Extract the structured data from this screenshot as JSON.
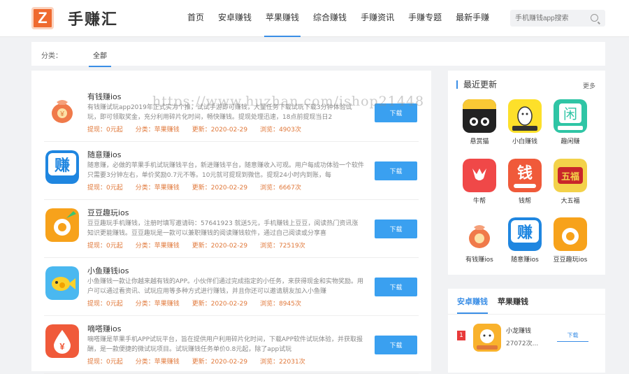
{
  "header": {
    "logo_letter": "Z",
    "logo_text": "手赚汇",
    "nav": [
      "首页",
      "安卓赚钱",
      "苹果赚钱",
      "综合赚钱",
      "手赚资讯",
      "手赚专题",
      "最新手赚"
    ],
    "active_nav": "苹果赚钱",
    "search_placeholder": "手机赚钱app搜索"
  },
  "filter": {
    "label": "分类：",
    "selected": "全部"
  },
  "apps": [
    {
      "name": "有钱赚ios",
      "desc": "有钱赚试玩app2019年正式实力个推，试试手游即可赚钱，大量任务下载试玩下载3分钟体验试玩，即可领取奖金，充分利用碎片化时间，畅快赚钱。提现处理迅速，18点前提现当日2",
      "withdraw": "提现：0元起",
      "category": "分类：苹果赚钱",
      "updated": "更新：2020-02-29",
      "views": "浏览：4903次",
      "button": "下载"
    },
    {
      "name": "随意赚ios",
      "desc": "随意赚，必做的苹果手机试玩赚钱平台，新进赚钱平台，随意赚收入可观。用户每成功体验一个软件只需要3分钟左右，单价奖励0.7元不等。10元就可提现到微信。提现24小时内到账，每",
      "withdraw": "提现：0元起",
      "category": "分类：苹果赚钱",
      "updated": "更新：2020-02-29",
      "views": "浏览：6667次",
      "button": "下载"
    },
    {
      "name": "豆豆趣玩ios",
      "desc": "豆豆趣玩手机赚钱，注册时填写邀请码：57641923 就送5元，手机赚钱上豆豆，阅读热门资讯涨知识更能赚钱。豆豆趣玩是一款可以兼职赚钱的阅读赚钱软件，通过自己阅读或分享喜",
      "withdraw": "提现：0元起",
      "category": "分类：苹果赚钱",
      "updated": "更新：2020-02-29",
      "views": "浏览：72519次",
      "button": "下载"
    },
    {
      "name": "小鱼赚钱ios",
      "desc": "小鱼赚钱一款让你越来越有钱的APP。小伙伴们通过完成指定的小任务，来获得现金和实物奖励。用户可以通过看资讯、试玩应用等多种方式进行赚钱，并且你还可以邀请朋友加入小鱼赚",
      "withdraw": "提现：0元起",
      "category": "分类：苹果赚钱",
      "updated": "更新：2020-02-29",
      "views": "浏览：8945次",
      "button": "下载"
    },
    {
      "name": "嘀嗒赚ios",
      "desc": "嘀嗒赚是苹果手机APP试玩平台，旨在提供用户利用碎片化时间，下载APP软件试玩体验，并获取报酬，是一款便捷的微试玩项目。试玩赚钱任务单价0.8元起，除了app试玩",
      "withdraw": "提现：0元起",
      "category": "分类：苹果赚钱",
      "updated": "更新：2020-02-29",
      "views": "浏览：22031次",
      "button": "下载"
    }
  ],
  "recent": {
    "title": "最近更新",
    "more": "更多",
    "items": [
      "悬赏猫",
      "小白赚钱",
      "趣闲赚",
      "牛帮",
      "钱帮",
      "大五福",
      "有钱赚ios",
      "随意赚ios",
      "豆豆趣玩ios"
    ]
  },
  "ranking": {
    "tabs": [
      "安卓赚钱",
      "苹果赚钱"
    ],
    "active_tab": "安卓赚钱",
    "items": [
      {
        "rank": "1",
        "name": "小龙赚钱",
        "views": "27072次...",
        "button": "下载"
      }
    ]
  },
  "watermark": "https://www.huzhan.com/ishop21448"
}
